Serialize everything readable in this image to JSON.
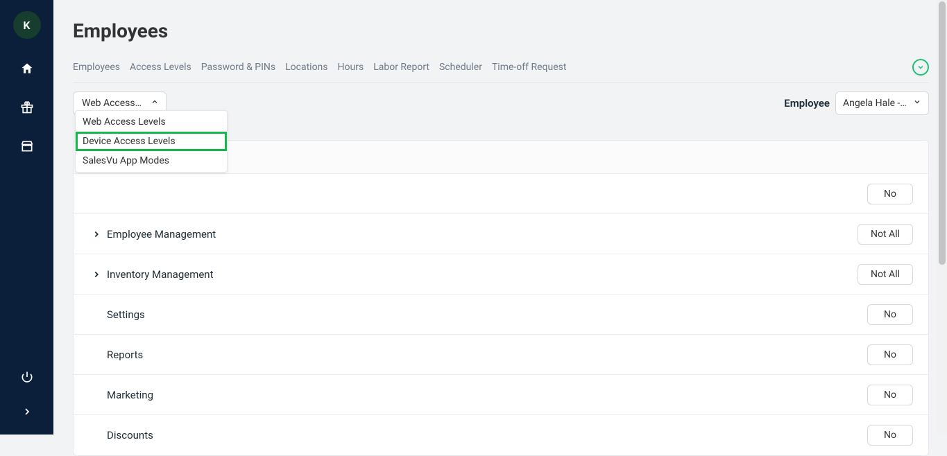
{
  "avatar": {
    "initial": "K"
  },
  "page": {
    "title": "Employees"
  },
  "tabs": [
    "Employees",
    "Access Levels",
    "Password & PINs",
    "Locations",
    "Hours",
    "Labor Report",
    "Scheduler",
    "Time-off Request"
  ],
  "access_dropdown": {
    "selected": "Web Access Le...",
    "options": [
      "Web Access Levels",
      "Device Access Levels",
      "SalesVu App Modes"
    ]
  },
  "employee_filter": {
    "label": "Employee",
    "selected": "Angela Hale - C..."
  },
  "rows": [
    {
      "label": "",
      "value": "No",
      "expandable": false,
      "hidden_label": true
    },
    {
      "label": "Employee Management",
      "value": "Not All",
      "expandable": true
    },
    {
      "label": "Inventory Management",
      "value": "Not All",
      "expandable": true
    },
    {
      "label": "Settings",
      "value": "No",
      "expandable": false
    },
    {
      "label": "Reports",
      "value": "No",
      "expandable": false
    },
    {
      "label": "Marketing",
      "value": "No",
      "expandable": false
    },
    {
      "label": "Discounts",
      "value": "No",
      "expandable": false
    }
  ]
}
